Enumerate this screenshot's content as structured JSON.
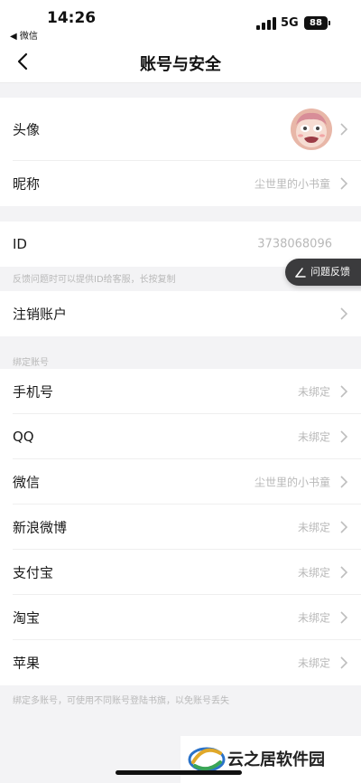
{
  "status_bar": {
    "time": "14:26",
    "back_app": "◀ 微信",
    "network": "5G",
    "battery": "88"
  },
  "nav": {
    "title": "账号与安全",
    "back_icon": "chevron-left-icon"
  },
  "profile": {
    "avatar_label": "头像",
    "nickname_label": "昵称",
    "nickname_value": "尘世里的小书童"
  },
  "id_section": {
    "label": "ID",
    "value": "3738068096",
    "hint": "反馈问题时可以提供ID给客服，长按复制"
  },
  "cancel_account": {
    "label": "注销账户"
  },
  "bind_section": {
    "title": "绑定账号",
    "items": [
      {
        "label": "手机号",
        "value": "未绑定"
      },
      {
        "label": "QQ",
        "value": "未绑定"
      },
      {
        "label": "微信",
        "value": "尘世里的小书童"
      },
      {
        "label": "新浪微博",
        "value": "未绑定"
      },
      {
        "label": "支付宝",
        "value": "未绑定"
      },
      {
        "label": "淘宝",
        "value": "未绑定"
      },
      {
        "label": "苹果",
        "value": "未绑定"
      }
    ],
    "footer": "绑定多账号，可使用不同账号登陆书旗，以免账号丢失"
  },
  "feedback_button": {
    "label": "问题反馈",
    "icon": "pen-icon"
  },
  "watermark": {
    "text": "云之居软件园"
  },
  "colors": {
    "background": "#f3f3f5",
    "secondary_text": "#b8b8b8",
    "feedback_bg": "#3b3b3d"
  }
}
